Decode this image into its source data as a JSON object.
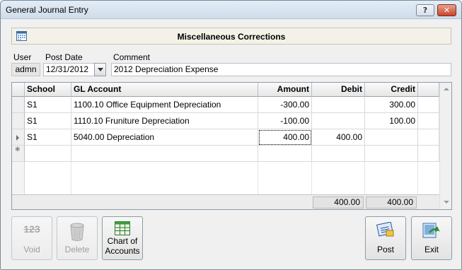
{
  "window": {
    "title": "General Journal Entry",
    "help_label": "?",
    "close_label": "✕"
  },
  "header": {
    "title": "Miscellaneous Corrections",
    "icon": "calendar-grid-icon"
  },
  "form": {
    "user_label": "User",
    "user_value": "admn",
    "post_date_label": "Post Date",
    "post_date_value": "12/31/2012",
    "comment_label": "Comment",
    "comment_value": "2012 Depreciation Expense"
  },
  "grid": {
    "columns": [
      "School",
      "GL Account",
      "Amount",
      "Debit",
      "Credit"
    ],
    "rows": [
      {
        "school": "S1",
        "account": "1100.10  Office Equipment Depreciation",
        "amount": "-300.00",
        "debit": "",
        "credit": "300.00"
      },
      {
        "school": "S1",
        "account": "1110.10  Fruniture Depreciation",
        "amount": "-100.00",
        "debit": "",
        "credit": "100.00"
      },
      {
        "school": "S1",
        "account": "5040.00  Depreciation",
        "amount": "400.00",
        "debit": "400.00",
        "credit": ""
      }
    ],
    "totals": {
      "debit": "400.00",
      "credit": "400.00"
    }
  },
  "buttons": {
    "void_label": "Void",
    "void_icon_text": "123",
    "delete_label": "Delete",
    "chart_label_1": "Chart of",
    "chart_label_2": "Accounts",
    "post_label": "Post",
    "exit_label": "Exit"
  },
  "colors": {
    "accent": "#1e5aa8",
    "header_bg": "#f4f1e8"
  }
}
